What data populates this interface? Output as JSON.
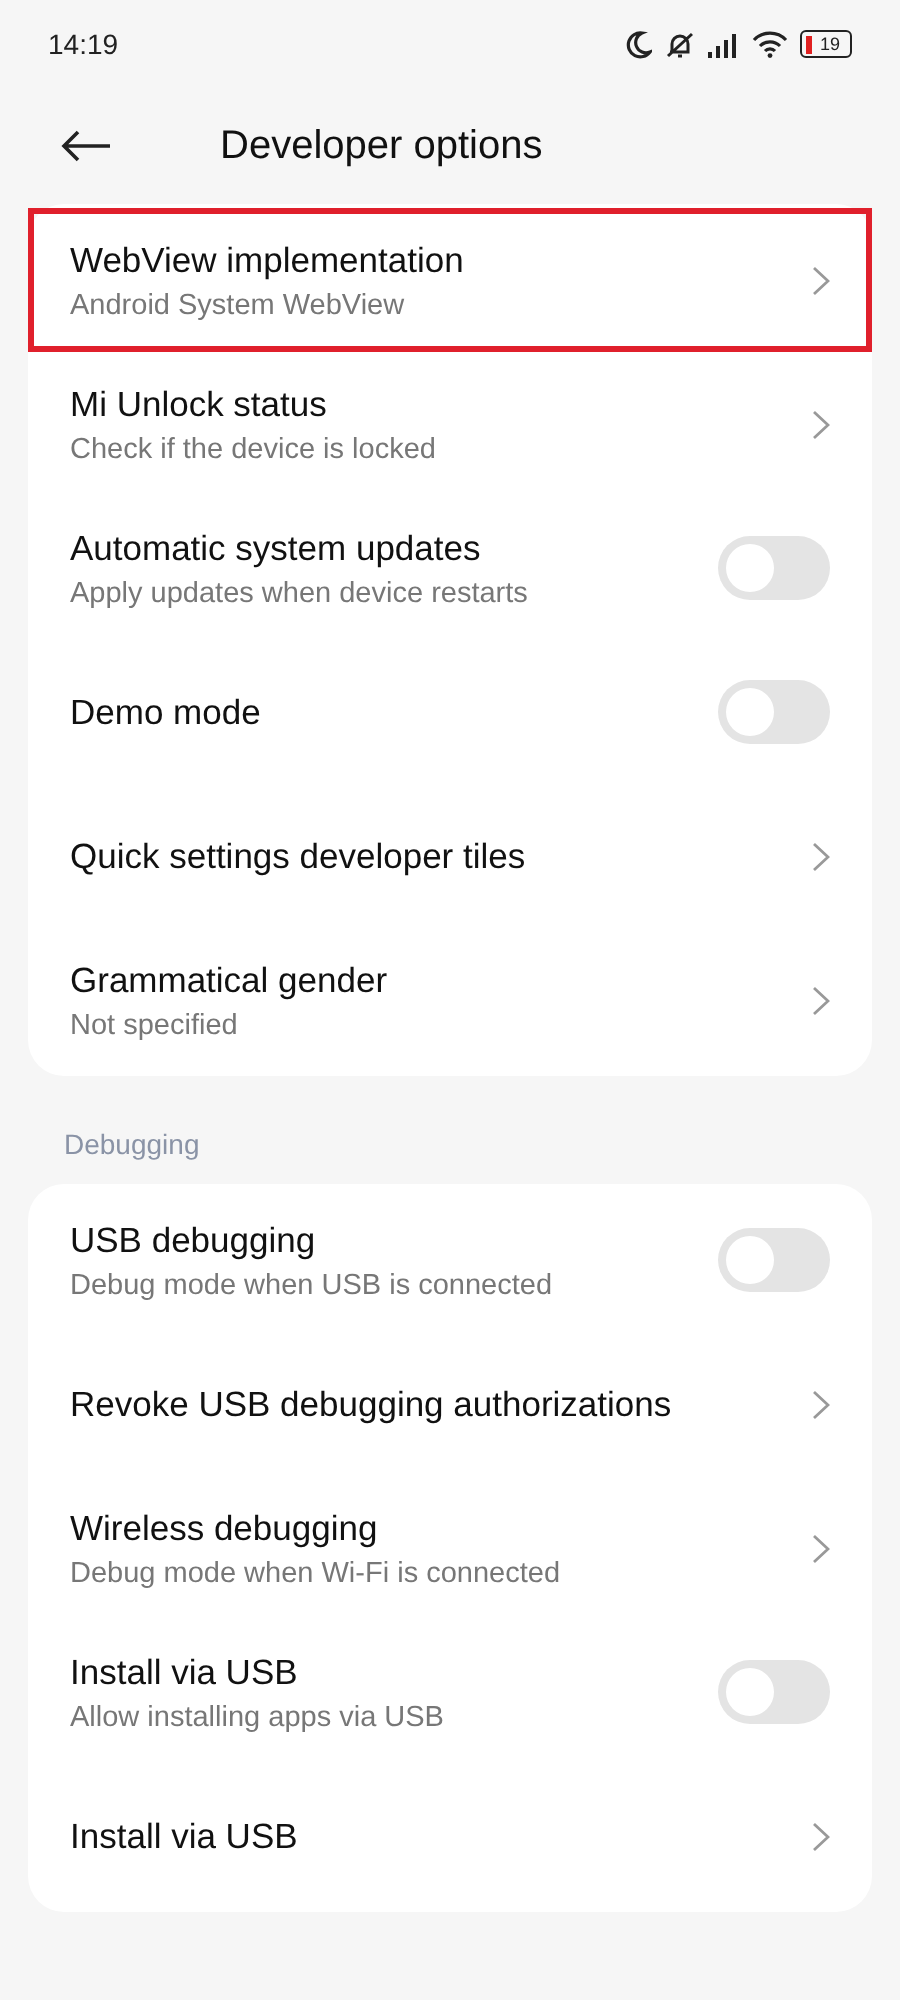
{
  "status_bar": {
    "time": "14:19",
    "battery": "19"
  },
  "header": {
    "title": "Developer options"
  },
  "sections": [
    {
      "items": [
        {
          "kind": "link",
          "title": "WebView implementation",
          "subtitle": "Android System WebView",
          "highlighted": true
        },
        {
          "kind": "link",
          "title": "Mi Unlock status",
          "subtitle": "Check if the device is locked",
          "highlighted": false
        },
        {
          "kind": "toggle",
          "title": "Automatic system updates",
          "subtitle": "Apply updates when device restarts",
          "on": false,
          "highlighted": false
        },
        {
          "kind": "toggle",
          "title": "Demo mode",
          "on": false,
          "highlighted": false
        },
        {
          "kind": "link",
          "title": "Quick settings developer tiles",
          "highlighted": false
        },
        {
          "kind": "link",
          "title": "Grammatical gender",
          "subtitle": "Not specified",
          "highlighted": false
        }
      ]
    },
    {
      "heading": "Debugging",
      "items": [
        {
          "kind": "toggle",
          "title": "USB debugging",
          "subtitle": "Debug mode when USB is connected",
          "on": false,
          "highlighted": false
        },
        {
          "kind": "link",
          "title": "Revoke USB debugging authorizations",
          "highlighted": false
        },
        {
          "kind": "link",
          "title": "Wireless debugging",
          "subtitle": "Debug mode when Wi-Fi is connected",
          "highlighted": false
        },
        {
          "kind": "toggle",
          "title": "Install via USB",
          "subtitle": "Allow installing apps via USB",
          "on": false,
          "highlighted": false
        },
        {
          "kind": "link",
          "title": "Install via USB",
          "highlighted": false
        }
      ]
    }
  ]
}
